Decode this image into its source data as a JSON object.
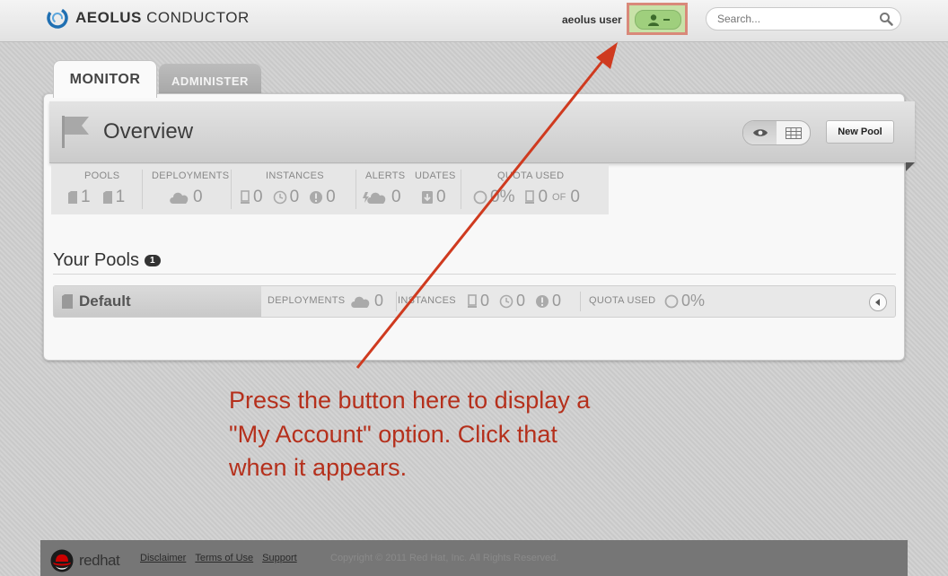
{
  "header": {
    "logo_brand": "AEOLUS",
    "logo_product": " CONDUCTOR",
    "username": "aeolus user",
    "search_placeholder": "Search..."
  },
  "tabs": [
    {
      "label": "MONITOR",
      "active": true
    },
    {
      "label": "ADMINISTER",
      "active": false
    }
  ],
  "overview": {
    "title": "Overview",
    "new_pool_label": "New Pool",
    "stats": {
      "pools_label": "POOLS",
      "pools_a": "1",
      "pools_b": "1",
      "deployments_label": "DEPLOYMENTS",
      "deployments": "0",
      "instances_label": "INSTANCES",
      "instances_total": "0",
      "instances_pending": "0",
      "instances_failed": "0",
      "alerts_label": "ALERTS",
      "alerts": "0",
      "updates_label": "UDATES",
      "updates": "0",
      "quota_label": "QUOTA USED",
      "quota_pct": "0%",
      "quota_used": "0",
      "quota_of": "OF",
      "quota_total": "0"
    }
  },
  "pools": {
    "title": "Your Pools",
    "count": "1",
    "rows": [
      {
        "name": "Default",
        "deployments_label": "DEPLOYMENTS",
        "deployments": "0",
        "instances_label": "INSTANCES",
        "instances_total": "0",
        "instances_pending": "0",
        "instances_failed": "0",
        "quota_label": "QUOTA USED",
        "quota_pct": "0%"
      }
    ]
  },
  "annotation": {
    "line1": "Press the button here to display a",
    "line2": "\"My Account\" option.  Click that",
    "line3": "when it appears."
  },
  "footer": {
    "brand": "redhat",
    "links": [
      "Disclaimer",
      "Terms of Use",
      "Support"
    ],
    "copyright": "Copyright © 2011 Red Hat, Inc. All Rights Reserved."
  },
  "colors": {
    "annotation": "#b5301c",
    "highlight_border": "#d9897a",
    "user_button": "#9fcf7d"
  }
}
